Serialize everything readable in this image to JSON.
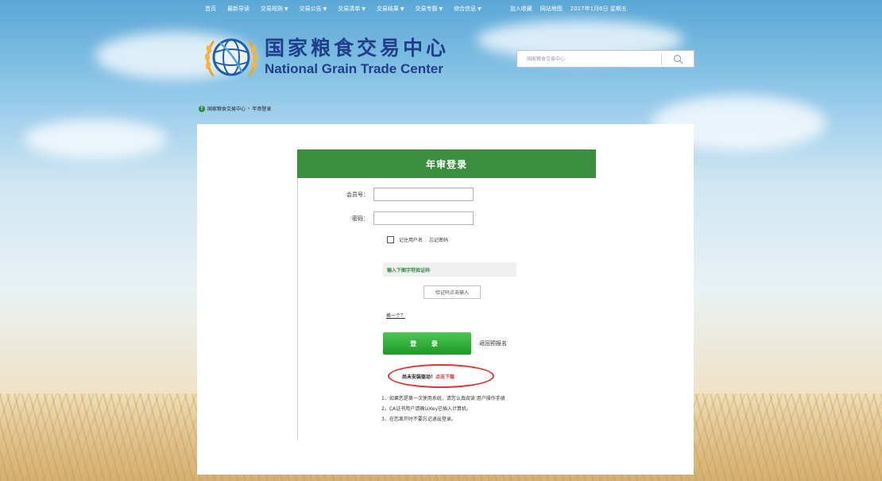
{
  "topnav": {
    "items": [
      {
        "label": "首页",
        "has_dropdown": false
      },
      {
        "label": "最新导读",
        "has_dropdown": false
      },
      {
        "label": "交易规则",
        "has_dropdown": true
      },
      {
        "label": "交易公告",
        "has_dropdown": true
      },
      {
        "label": "交易清单",
        "has_dropdown": true
      },
      {
        "label": "交易结果",
        "has_dropdown": true
      },
      {
        "label": "交易专题",
        "has_dropdown": true
      },
      {
        "label": "综合信息",
        "has_dropdown": true
      }
    ],
    "favorite": "加入收藏",
    "sitemap": "网站地图",
    "date": "2017年1月6日 星期五"
  },
  "logo": {
    "cn": "国家粮食交易中心",
    "en": "National Grain Trade Center"
  },
  "search": {
    "placeholder": "国家粮食交易中心",
    "icon": "search-icon"
  },
  "breadcrumb": {
    "home": "国家粮食交易中心",
    "separator": "›",
    "current": "年审登录"
  },
  "login": {
    "title": "年审登录",
    "member_label": "会员号：",
    "password_label": "密码：",
    "remember_label": "记住用户名",
    "forgot_label": "忘记密码",
    "captcha_prompt": "输入下图字符验证码",
    "captcha_placeholder": "验证码点击输入",
    "change_label": "换一个？",
    "submit_label": "登 录",
    "back_label": "返回预报名"
  },
  "driver": {
    "prefix": "尚未安装驱动！",
    "link": "点击下载"
  },
  "notes": [
    "1、如果您是第一次使用系统，请您认真阅读 用户操作手册",
    "2、CA证书用户请确认Key已插入计算机。",
    "3、在您离开时不要忘记退出登录。"
  ],
  "colors": {
    "brand_green": "#3a8e3e",
    "logo_blue": "#1f3f8a",
    "alert_red": "#e0352e"
  }
}
